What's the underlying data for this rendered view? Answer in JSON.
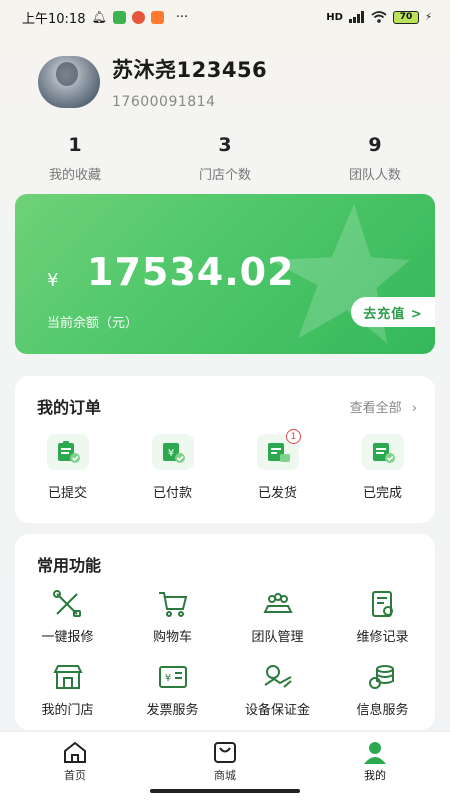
{
  "status_bar": {
    "time": "上午10:18",
    "dots": "···",
    "signal": "HD",
    "battery": "70"
  },
  "profile": {
    "username": "苏沐尧123456",
    "phone": "17600091814"
  },
  "stats": [
    {
      "value": "1",
      "label": "我的收藏"
    },
    {
      "value": "3",
      "label": "门店个数"
    },
    {
      "value": "9",
      "label": "团队人数"
    }
  ],
  "balance": {
    "currency": "¥",
    "amount": "17534.02",
    "label": "当前余额（元）",
    "recharge": "去充值 >"
  },
  "orders": {
    "title": "我的订单",
    "view_all": "查看全部",
    "items": [
      {
        "label": "已提交",
        "icon": "submitted-icon",
        "badge": ""
      },
      {
        "label": "已付款",
        "icon": "paid-icon",
        "badge": ""
      },
      {
        "label": "已发货",
        "icon": "shipped-icon",
        "badge": "1"
      },
      {
        "label": "已完成",
        "icon": "completed-icon",
        "badge": ""
      }
    ]
  },
  "functions": {
    "title": "常用功能",
    "items": [
      {
        "label": "一键报修",
        "icon": "wrench-icon"
      },
      {
        "label": "购物车",
        "icon": "cart-icon"
      },
      {
        "label": "团队管理",
        "icon": "team-icon"
      },
      {
        "label": "维修记录",
        "icon": "record-icon"
      },
      {
        "label": "我的门店",
        "icon": "store-icon"
      },
      {
        "label": "发票服务",
        "icon": "invoice-icon"
      },
      {
        "label": "设备保证金",
        "icon": "deposit-icon"
      },
      {
        "label": "信息服务",
        "icon": "info-service-icon"
      }
    ]
  },
  "tabbar": [
    {
      "label": "首页",
      "icon": "home-icon",
      "active": false
    },
    {
      "label": "商城",
      "icon": "shop-bag-icon",
      "active": false
    },
    {
      "label": "我的",
      "icon": "user-icon",
      "active": true
    }
  ],
  "colors": {
    "primary": "#2ca94f",
    "card_green": "#4fc76a",
    "badge_red": "#e04848"
  }
}
